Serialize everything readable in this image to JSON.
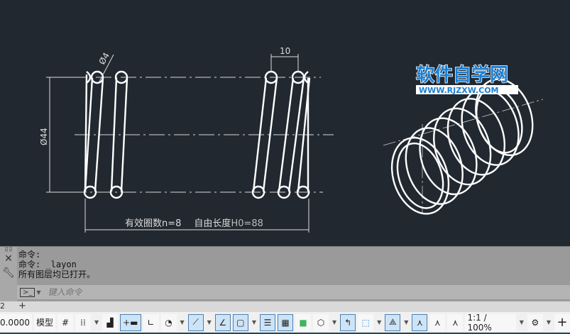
{
  "drawing": {
    "dim_wire": "Ø4",
    "dim_dia": "Ø44",
    "dim_pitch": "10",
    "note_coils_label": "有效圈数",
    "note_coils_value": "n=8",
    "note_len_label": "自由长度",
    "note_len_value": "H0=88"
  },
  "watermark": {
    "title": "软件自学网",
    "url": "WWW.RJZXW.COM"
  },
  "command": {
    "history": [
      "命令:",
      "命令: _layon",
      "所有图层均已打开。"
    ],
    "placeholder": "键入命令"
  },
  "tabs": {
    "current": "2",
    "add": "+"
  },
  "status": {
    "coords": "0.0000",
    "model": "模型",
    "scale": "1:1 / 100%"
  },
  "colors": {
    "canvas": "#212830",
    "accent": "#1a7fd4"
  }
}
